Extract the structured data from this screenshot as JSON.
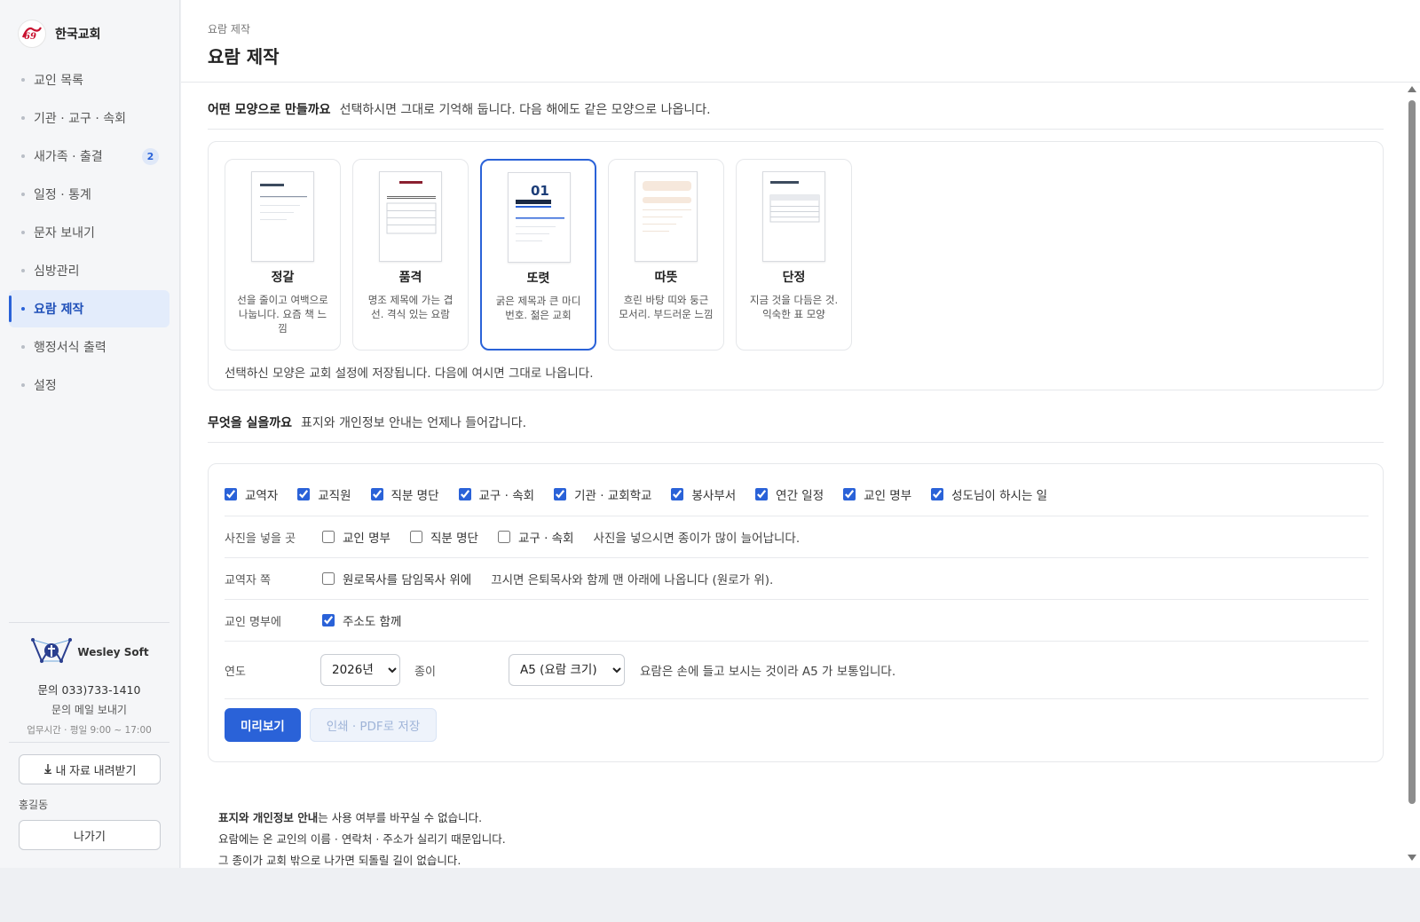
{
  "brand": {
    "name": "한국교회",
    "logo_text": "69"
  },
  "nav": {
    "items": [
      {
        "label": "교인 목록"
      },
      {
        "label": "기관 · 교구 · 속회"
      },
      {
        "label": "새가족 · 출결",
        "badge": "2"
      },
      {
        "label": "일정 · 통계"
      },
      {
        "label": "문자 보내기"
      },
      {
        "label": "심방관리"
      },
      {
        "label": "요람 제작",
        "active": true
      },
      {
        "label": "행정서식 출력"
      },
      {
        "label": "설정"
      }
    ]
  },
  "company": {
    "name": "Wesley Soft",
    "phone": "문의 033)733-1410",
    "mail_link": "문의 메일 보내기",
    "hours": "업무시간 · 평일 9:00 ~ 17:00"
  },
  "sidebar_bottom": {
    "download_label": "내 자료 내려받기",
    "user_name": "홍길동",
    "logout_label": "나가기"
  },
  "header": {
    "breadcrumb": "요람 제작",
    "title": "요람 제작"
  },
  "style_section": {
    "title": "어떤 모양으로 만들까요",
    "subtitle": "선택하시면 그대로 기억해 둡니다. 다음 해에도 같은 모양으로 나옵니다.",
    "cards": [
      {
        "title": "정갈",
        "desc": "선을 줄이고 여백으로 나눕니다. 요즘 책 느낌"
      },
      {
        "title": "품격",
        "desc": "명조 제목에 가는 겹선. 격식 있는 요람"
      },
      {
        "title": "또렷",
        "desc": "굵은 제목과 큰 마디 번호. 젊은 교회",
        "thumb_number": "01",
        "selected": true
      },
      {
        "title": "따뜻",
        "desc": "흐린 바탕 띠와 둥근 모서리. 부드러운 느낌"
      },
      {
        "title": "단정",
        "desc": "지금 것을 다듬은 것. 익숙한 표 모양"
      }
    ],
    "note": "선택하신 모양은 교회 설정에 저장됩니다. 다음에 여시면 그대로 나옵니다."
  },
  "content_section": {
    "title": "무엇을 실을까요",
    "subtitle": "표지와 개인정보 안내는 언제나 들어갑니다.",
    "include_items": [
      {
        "label": "교역자",
        "checked": true
      },
      {
        "label": "교직원",
        "checked": true
      },
      {
        "label": "직분 명단",
        "checked": true
      },
      {
        "label": "교구 · 속회",
        "checked": true
      },
      {
        "label": "기관 · 교회학교",
        "checked": true
      },
      {
        "label": "봉사부서",
        "checked": true
      },
      {
        "label": "연간 일정",
        "checked": true
      },
      {
        "label": "교인 명부",
        "checked": true
      },
      {
        "label": "성도님이 하시는 일",
        "checked": true
      }
    ],
    "photo": {
      "label": "사진을 넣을 곳",
      "items": [
        {
          "label": "교인 명부",
          "checked": false
        },
        {
          "label": "직분 명단",
          "checked": false
        },
        {
          "label": "교구 · 속회",
          "checked": false
        }
      ],
      "hint": "사진을 넣으시면 종이가 많이 늘어납니다."
    },
    "clergy": {
      "label": "교역자 쪽",
      "option": "원로목사를 담임목사 위에",
      "checked": false,
      "hint": "끄시면 은퇴목사와 함께 맨 아래에 나옵니다 (원로가 위)."
    },
    "directory": {
      "label": "교인 명부에",
      "option": "주소도 함께",
      "checked": true
    },
    "year": {
      "label": "연도",
      "value": "2026년"
    },
    "paper": {
      "label": "종이",
      "value": "A5 (요람 크기)",
      "hint": "요람은 손에 들고 보시는 것이라 A5 가 보통입니다."
    },
    "preview_label": "미리보기",
    "print_label": "인쇄 · PDF로 저장"
  },
  "notice": {
    "line1_bold": "표지와 개인정보 안내",
    "line1_rest": "는 사용 여부를 바꾸실 수 없습니다.",
    "line2": "요람에는 온 교인의 이름 · 연락처 · 주소가 실리기 때문입니다.",
    "line3": "그 종이가 교회 밖으로 나가면 되돌릴 길이 없습니다."
  },
  "colors": {
    "accent": "#2a62d8",
    "active_bg": "#e3ecfb",
    "sidebar_bg": "#f5f6f8"
  }
}
